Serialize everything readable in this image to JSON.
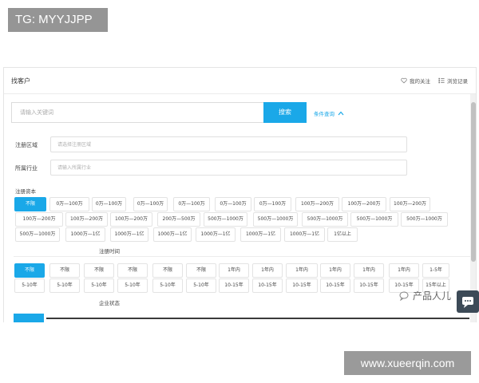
{
  "watermark_top": "TG: MYYJJPP",
  "watermark_bottom": "www.xueerqin.com",
  "watermark_brand": "产品人儿",
  "header": {
    "title": "找客户",
    "favorites_label": "我的关注",
    "history_label": "浏览记录"
  },
  "search": {
    "placeholder": "请输入关键词",
    "button_label": "搜索",
    "advanced_label": "条件查询"
  },
  "fields": {
    "region_label": "注册区域",
    "region_placeholder": "请选择注册区域",
    "industry_label": "所属行业",
    "industry_placeholder": "请输入所属行业"
  },
  "capital": {
    "label": "注册资本",
    "options": [
      "不限",
      "0万—100万",
      "0万—100万",
      "0万—100万",
      "0万—100万",
      "0万—100万",
      "0万—100万",
      "100万—200万",
      "100万—200万",
      "100万—200万",
      "100万—200万",
      "100万—200万",
      "100万—200万",
      "200万—500万",
      "500万—1000万",
      "500万—1000万",
      "500万—1000万",
      "500万—1000万",
      "500万—1000万",
      "500万—1000万",
      "1000万—1亿",
      "1000万—1亿",
      "1000万—1亿",
      "1000万—1亿",
      "1000万—1亿",
      "1000万—1亿",
      "1亿以上"
    ]
  },
  "reg_time": {
    "label": "注册时间",
    "options": [
      "不限",
      "不限",
      "不限",
      "不限",
      "不限",
      "不限",
      "1年内",
      "1年内",
      "1年内",
      "1年内",
      "1年内",
      "1年内",
      "1-5年",
      "5-10年",
      "5-10年",
      "5-10年",
      "5-10年",
      "5-10年",
      "5-10年",
      "10-15年",
      "10-15年",
      "10-15年",
      "10-15年",
      "10-15年",
      "10-15年",
      "15年以上"
    ]
  },
  "status": {
    "label": "企业状态"
  },
  "colors": {
    "accent": "#1aa8e8",
    "chip_border": "#e3e3e3",
    "watermark_bg": "#959595"
  }
}
